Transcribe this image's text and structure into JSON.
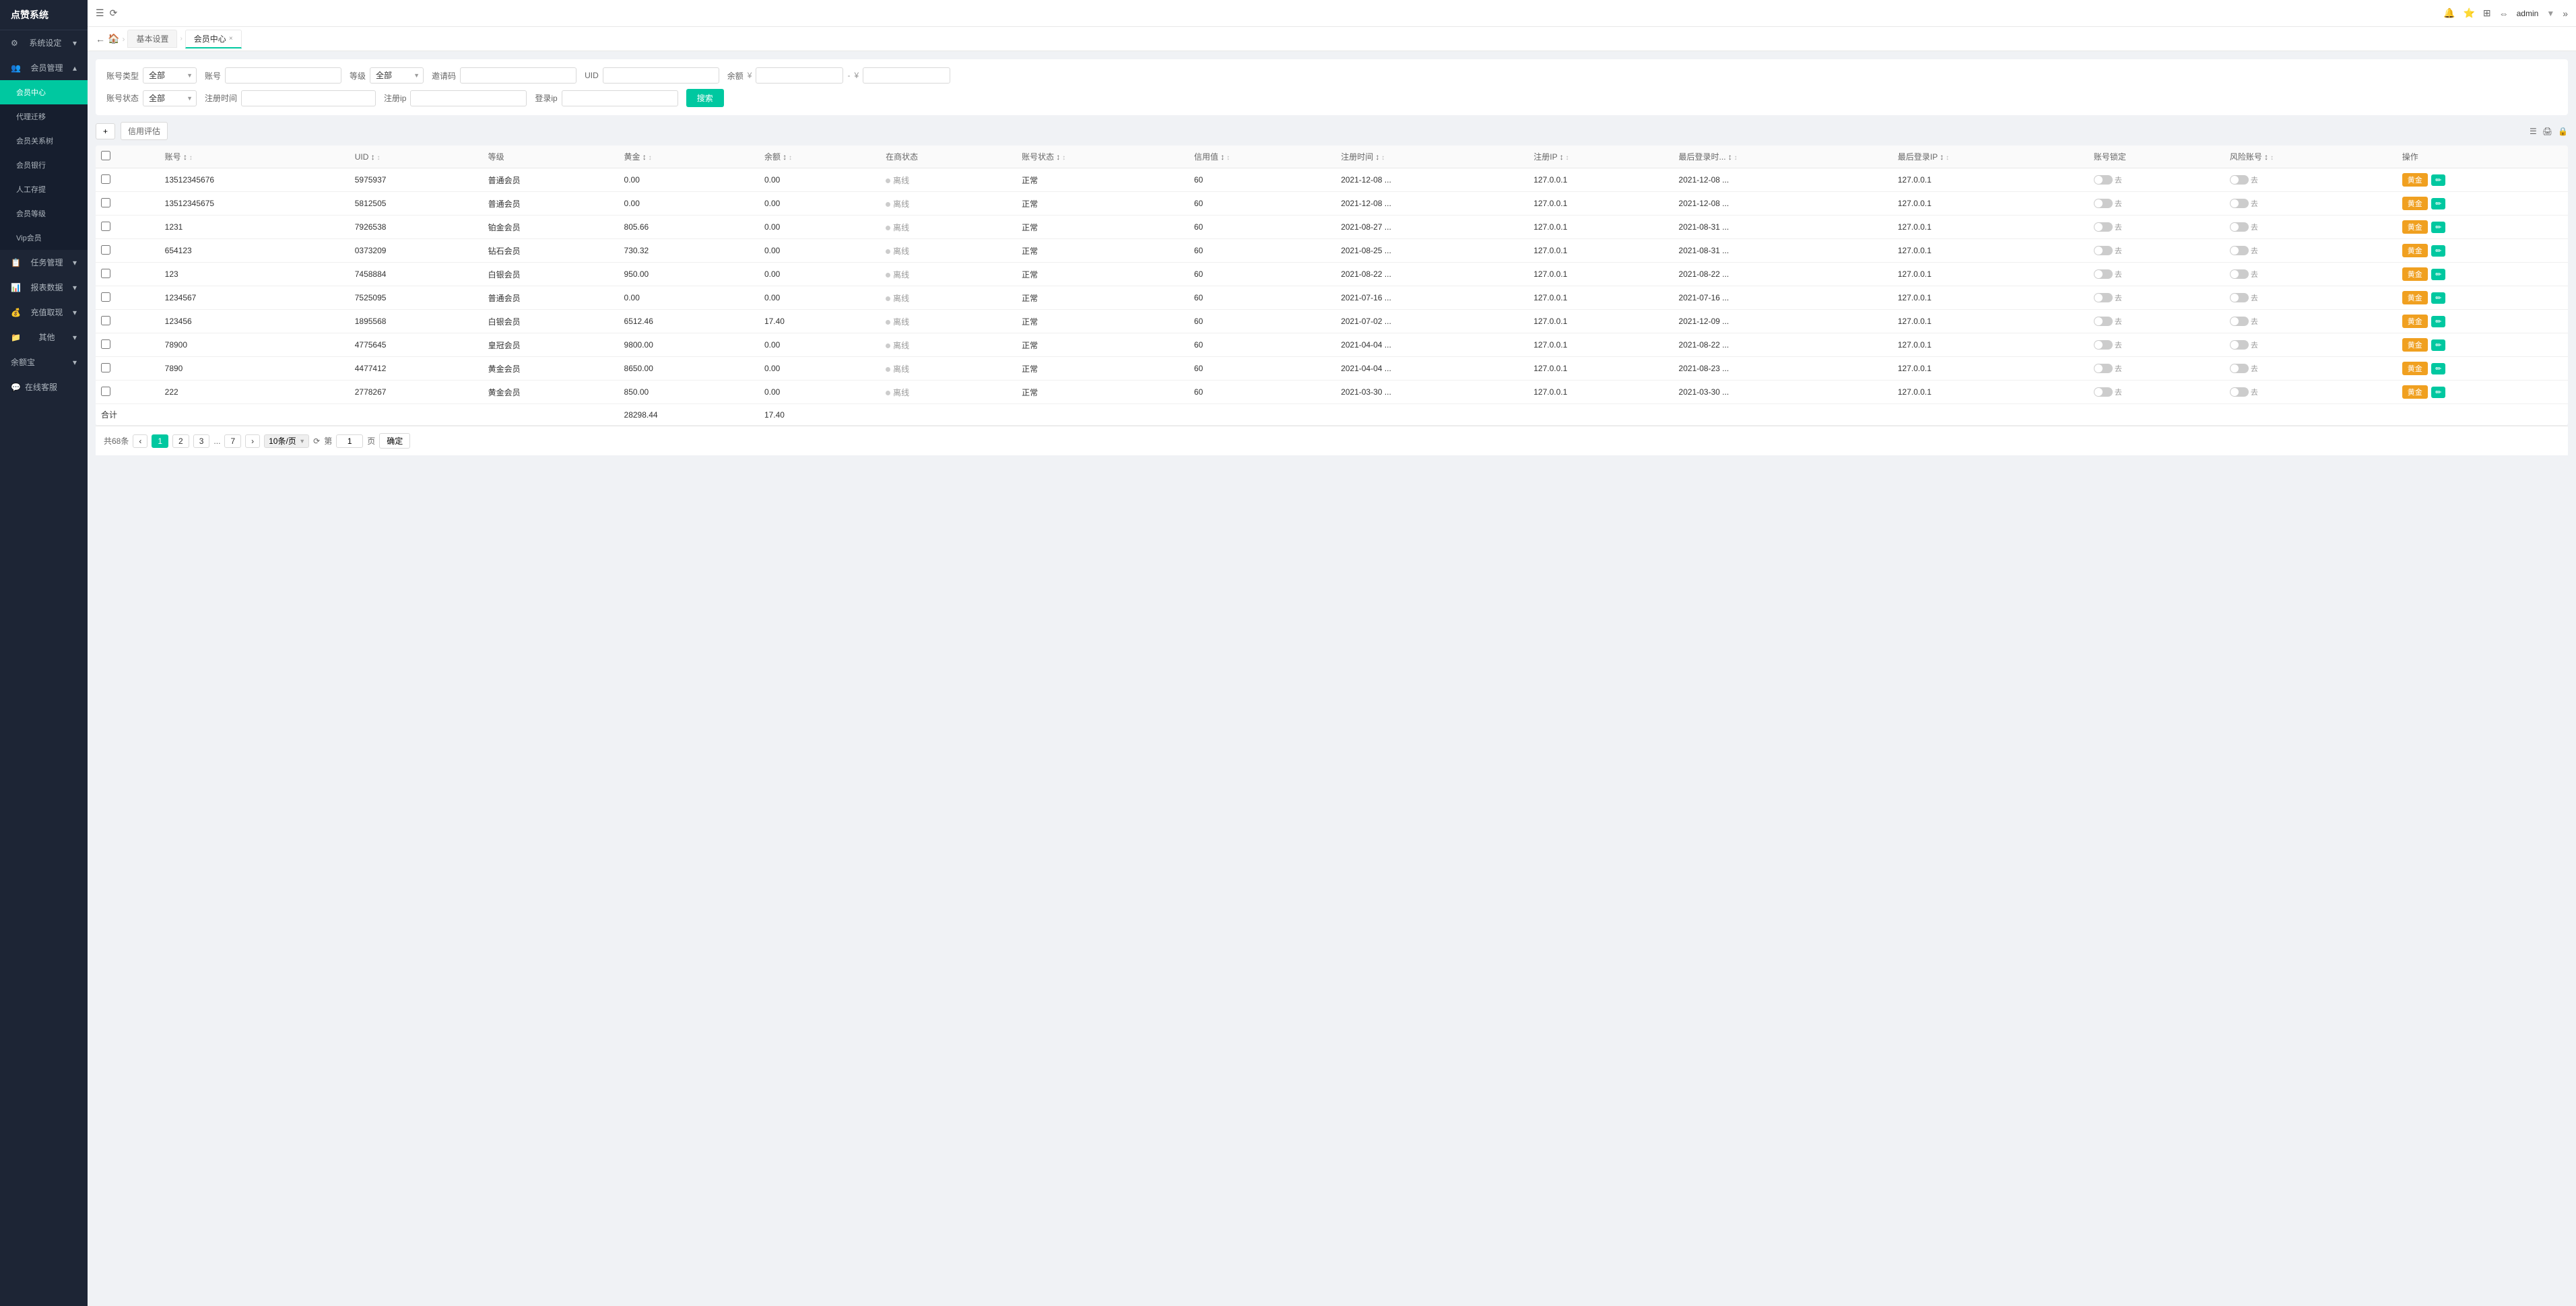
{
  "app": {
    "title": "点赞系统",
    "admin_label": "admin"
  },
  "sidebar": {
    "logo": "点赞系统",
    "items": [
      {
        "id": "system-settings",
        "label": "系统设定",
        "icon": "⚙",
        "expanded": true
      },
      {
        "id": "member-management",
        "label": "会员管理",
        "icon": "👥",
        "expanded": true
      },
      {
        "id": "member-center",
        "label": "会员中心",
        "active": true
      },
      {
        "id": "agent-transfer",
        "label": "代理迁移"
      },
      {
        "id": "member-tree",
        "label": "会员关系树"
      },
      {
        "id": "member-bank",
        "label": "会员银行"
      },
      {
        "id": "manual-deposit",
        "label": "人工存提"
      },
      {
        "id": "member-grade",
        "label": "会员等级"
      },
      {
        "id": "vip-member",
        "label": "Vip会员"
      },
      {
        "id": "task-management",
        "label": "任务管理",
        "icon": "📋"
      },
      {
        "id": "report-data",
        "label": "报表数据",
        "icon": "📊"
      },
      {
        "id": "deposit-withdrawal",
        "label": "充值取现",
        "icon": "💰"
      },
      {
        "id": "other",
        "label": "其他",
        "icon": "📁"
      },
      {
        "id": "balance-treasure",
        "label": "余额宝"
      },
      {
        "id": "online-service",
        "label": "在线客服",
        "icon": "💬"
      }
    ]
  },
  "topbar": {
    "nav_icons": [
      "←",
      "→",
      "🏠",
      "⟳"
    ],
    "right_icons": [
      "🔔",
      "⭐",
      "⊞",
      "→|"
    ],
    "admin": "admin ▼"
  },
  "breadcrumb": {
    "tabs": [
      {
        "label": "基本设置",
        "active": false
      },
      {
        "label": "会员中心",
        "active": true,
        "closable": true
      }
    ]
  },
  "filters": {
    "account_type_label": "账号类型",
    "account_type_value": "全部",
    "account_label": "账号",
    "account_placeholder": "",
    "grade_label": "等级",
    "grade_value": "全部",
    "invite_code_label": "邀请码",
    "uid_label": "UID",
    "balance_label": "余额",
    "balance_min": "",
    "balance_max": "",
    "account_status_label": "账号状态",
    "account_status_value": "全部",
    "reg_time_label": "注册时间",
    "reg_ip_label": "注册ip",
    "login_ip_label": "登录ip",
    "search_btn": "搜索"
  },
  "toolbar": {
    "add_icon": "+",
    "credit_label": "信用评估",
    "print_icon": "🖨",
    "export_icon": "⬇",
    "lock_icon": "🔒"
  },
  "table": {
    "columns": [
      {
        "key": "cb",
        "label": ""
      },
      {
        "key": "account",
        "label": "账号",
        "sortable": true
      },
      {
        "key": "uid",
        "label": "UID",
        "sortable": true
      },
      {
        "key": "grade",
        "label": "等级"
      },
      {
        "key": "gold",
        "label": "黄金",
        "sortable": true
      },
      {
        "key": "balance",
        "label": "余额",
        "sortable": true
      },
      {
        "key": "online_status",
        "label": "在商状态"
      },
      {
        "key": "account_status",
        "label": "账号状态",
        "sortable": true
      },
      {
        "key": "credit",
        "label": "信用值",
        "sortable": true
      },
      {
        "key": "reg_time",
        "label": "注册时间",
        "sortable": true
      },
      {
        "key": "reg_ip",
        "label": "注册IP",
        "sortable": true
      },
      {
        "key": "last_login_time",
        "label": "最后登录时...",
        "sortable": true
      },
      {
        "key": "last_login_ip",
        "label": "最后登录IP",
        "sortable": true
      },
      {
        "key": "account_lock",
        "label": "账号锁定"
      },
      {
        "key": "risk_number",
        "label": "风险账号",
        "sortable": true
      },
      {
        "key": "action",
        "label": "操作"
      }
    ],
    "rows": [
      {
        "account": "13512345676",
        "uid": "5975937",
        "grade": "普通会员",
        "gold": "0.00",
        "balance": "0.00",
        "online_status": "离线",
        "account_status": "正常",
        "credit": "60",
        "reg_time": "2021-12-08 ...",
        "reg_ip": "127.0.0.1",
        "last_login_time": "2021-12-08 ...",
        "last_login_ip": "127.0.0.1",
        "account_lock_on": false,
        "risk_number_on": false
      },
      {
        "account": "13512345675",
        "uid": "5812505",
        "grade": "普通会员",
        "gold": "0.00",
        "balance": "0.00",
        "online_status": "离线",
        "account_status": "正常",
        "credit": "60",
        "reg_time": "2021-12-08 ...",
        "reg_ip": "127.0.0.1",
        "last_login_time": "2021-12-08 ...",
        "last_login_ip": "127.0.0.1",
        "account_lock_on": false,
        "risk_number_on": false
      },
      {
        "account": "1231",
        "uid": "7926538",
        "grade": "铂金会员",
        "gold": "805.66",
        "balance": "0.00",
        "online_status": "离线",
        "account_status": "正常",
        "credit": "60",
        "reg_time": "2021-08-27 ...",
        "reg_ip": "127.0.0.1",
        "last_login_time": "2021-08-31 ...",
        "last_login_ip": "127.0.0.1",
        "account_lock_on": false,
        "risk_number_on": false
      },
      {
        "account": "654123",
        "uid": "0373209",
        "grade": "钻石会员",
        "gold": "730.32",
        "balance": "0.00",
        "online_status": "离线",
        "account_status": "正常",
        "credit": "60",
        "reg_time": "2021-08-25 ...",
        "reg_ip": "127.0.0.1",
        "last_login_time": "2021-08-31 ...",
        "last_login_ip": "127.0.0.1",
        "account_lock_on": false,
        "risk_number_on": false
      },
      {
        "account": "123",
        "uid": "7458884",
        "grade": "白银会员",
        "gold": "950.00",
        "balance": "0.00",
        "online_status": "离线",
        "account_status": "正常",
        "credit": "60",
        "reg_time": "2021-08-22 ...",
        "reg_ip": "127.0.0.1",
        "last_login_time": "2021-08-22 ...",
        "last_login_ip": "127.0.0.1",
        "account_lock_on": false,
        "risk_number_on": false
      },
      {
        "account": "1234567",
        "uid": "7525095",
        "grade": "普通会员",
        "gold": "0.00",
        "balance": "0.00",
        "online_status": "离线",
        "account_status": "正常",
        "credit": "60",
        "reg_time": "2021-07-16 ...",
        "reg_ip": "127.0.0.1",
        "last_login_time": "2021-07-16 ...",
        "last_login_ip": "127.0.0.1",
        "account_lock_on": false,
        "risk_number_on": false
      },
      {
        "account": "123456",
        "uid": "1895568",
        "grade": "白银会员",
        "gold": "6512.46",
        "balance": "17.40",
        "online_status": "离线",
        "account_status": "正常",
        "credit": "60",
        "reg_time": "2021-07-02 ...",
        "reg_ip": "127.0.0.1",
        "last_login_time": "2021-12-09 ...",
        "last_login_ip": "127.0.0.1",
        "account_lock_on": false,
        "risk_number_on": false
      },
      {
        "account": "78900",
        "uid": "4775645",
        "grade": "皇冠会员",
        "gold": "9800.00",
        "balance": "0.00",
        "online_status": "离线",
        "account_status": "正常",
        "credit": "60",
        "reg_time": "2021-04-04 ...",
        "reg_ip": "127.0.0.1",
        "last_login_time": "2021-08-22 ...",
        "last_login_ip": "127.0.0.1",
        "account_lock_on": false,
        "risk_number_on": false
      },
      {
        "account": "7890",
        "uid": "4477412",
        "grade": "黄金会员",
        "gold": "8650.00",
        "balance": "0.00",
        "online_status": "离线",
        "account_status": "正常",
        "credit": "60",
        "reg_time": "2021-04-04 ...",
        "reg_ip": "127.0.0.1",
        "last_login_time": "2021-08-23 ...",
        "last_login_ip": "127.0.0.1",
        "account_lock_on": false,
        "risk_number_on": false
      },
      {
        "account": "222",
        "uid": "2778267",
        "grade": "黄金会员",
        "gold": "850.00",
        "balance": "0.00",
        "online_status": "离线",
        "account_status": "正常",
        "credit": "60",
        "reg_time": "2021-03-30 ...",
        "reg_ip": "127.0.0.1",
        "last_login_time": "2021-03-30 ...",
        "last_login_ip": "127.0.0.1",
        "account_lock_on": false,
        "risk_number_on": false
      }
    ],
    "footer": {
      "label": "合计",
      "gold_total": "28298.44",
      "balance_total": "17.40"
    }
  },
  "pagination": {
    "total_text": "共68条",
    "pages": [
      "1",
      "2",
      "3",
      "...",
      "7"
    ],
    "current_page": "1",
    "per_page": "10条/页",
    "go_label": "确定",
    "page_input_label": "第",
    "page_suffix": "页"
  }
}
